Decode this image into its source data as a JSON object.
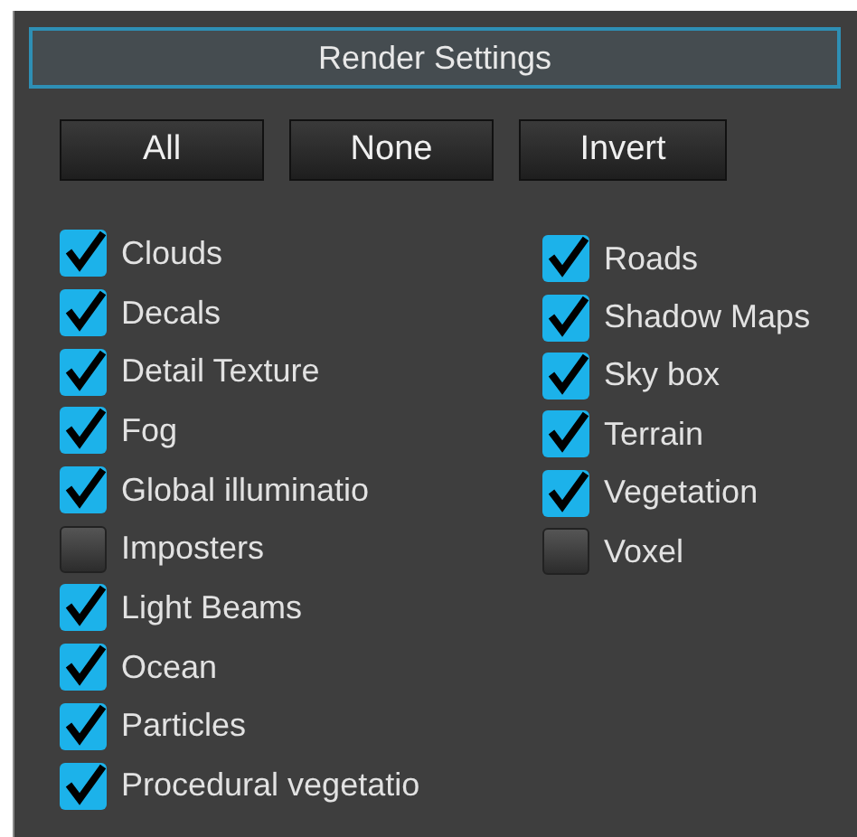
{
  "panel": {
    "title": "Render Settings"
  },
  "buttons": [
    "All",
    "None",
    "Invert"
  ],
  "columns": [
    [
      {
        "label": "Clouds",
        "checked": true
      },
      {
        "label": "Decals",
        "checked": true
      },
      {
        "label": "Detail Texture",
        "checked": true
      },
      {
        "label": "Fog",
        "checked": true
      },
      {
        "label": "Global illuminatio",
        "checked": true
      },
      {
        "label": "Imposters",
        "checked": false
      },
      {
        "label": "Light Beams",
        "checked": true
      },
      {
        "label": "Ocean",
        "checked": true
      },
      {
        "label": "Particles",
        "checked": true
      },
      {
        "label": "Procedural vegetatio",
        "checked": true
      }
    ],
    [
      {
        "label": "Roads",
        "checked": true
      },
      {
        "label": "Shadow Maps",
        "checked": true
      },
      {
        "label": "Sky box",
        "checked": true
      },
      {
        "label": "Terrain",
        "checked": true
      },
      {
        "label": "Vegetation",
        "checked": true
      },
      {
        "label": "Voxel",
        "checked": false
      }
    ]
  ]
}
